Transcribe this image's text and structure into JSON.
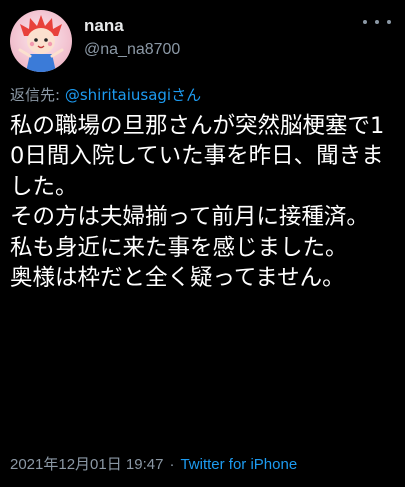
{
  "user": {
    "display_name": "nana",
    "handle": "@na_na8700"
  },
  "reply": {
    "prefix": "返信先: ",
    "to_handle": "@shiritaiusagi",
    "suffix": "さん"
  },
  "tweet": {
    "text": "私の職場の旦那さんが突然脳梗塞で10日間入院していた事を昨日、聞きました。\nその方は夫婦揃って前月に接種済。\n私も身近に来た事を感じました。\n奥様は枠だと全く疑ってません。"
  },
  "meta": {
    "timestamp": "2021年12月01日 19:47",
    "separator": "·",
    "source": "Twitter for iPhone"
  },
  "colors": {
    "background": "#000000",
    "text": "#ffffff",
    "muted": "#8b98a5",
    "link": "#1d9bf0"
  },
  "icons": {
    "more": "more-options-icon"
  }
}
